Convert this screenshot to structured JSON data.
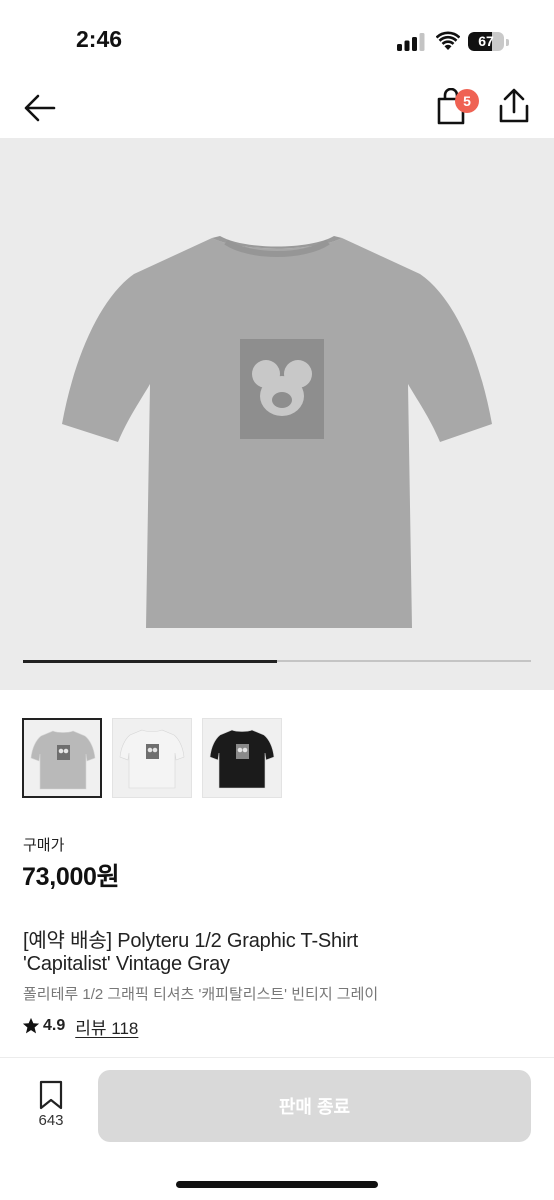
{
  "status_bar": {
    "time": "2:46",
    "battery": "67",
    "battery_level": 0.67
  },
  "nav": {
    "back_icon": "arrow-left-icon",
    "cart_icon": "shopping-bag-icon",
    "cart_badge": "5",
    "share_icon": "share-icon"
  },
  "gallery": {
    "progress": 0.5,
    "thumbnails": [
      {
        "color": "#b9b9b9",
        "selected": true
      },
      {
        "color": "#f4f4f4",
        "selected": false
      },
      {
        "color": "#1b1b1b",
        "selected": false
      }
    ]
  },
  "product": {
    "price_label": "구매가",
    "price": "73,000원",
    "title_line1": "[예약 배송] Polyteru 1/2 Graphic T-Shirt",
    "title_line2": "'Capitalist' Vintage Gray",
    "subtitle": "폴리테루 1/2 그래픽 티셔츠 '캐피탈리스트' 빈티지 그레이",
    "rating": "4.9",
    "reviews": "리뷰 118"
  },
  "bottom_bar": {
    "bookmark_count": "643",
    "sold_label": "판매 종료"
  },
  "colors": {
    "badge": "#ef6253",
    "sold_button": "#d9d9d9",
    "hero_background": "#ebebeb"
  }
}
